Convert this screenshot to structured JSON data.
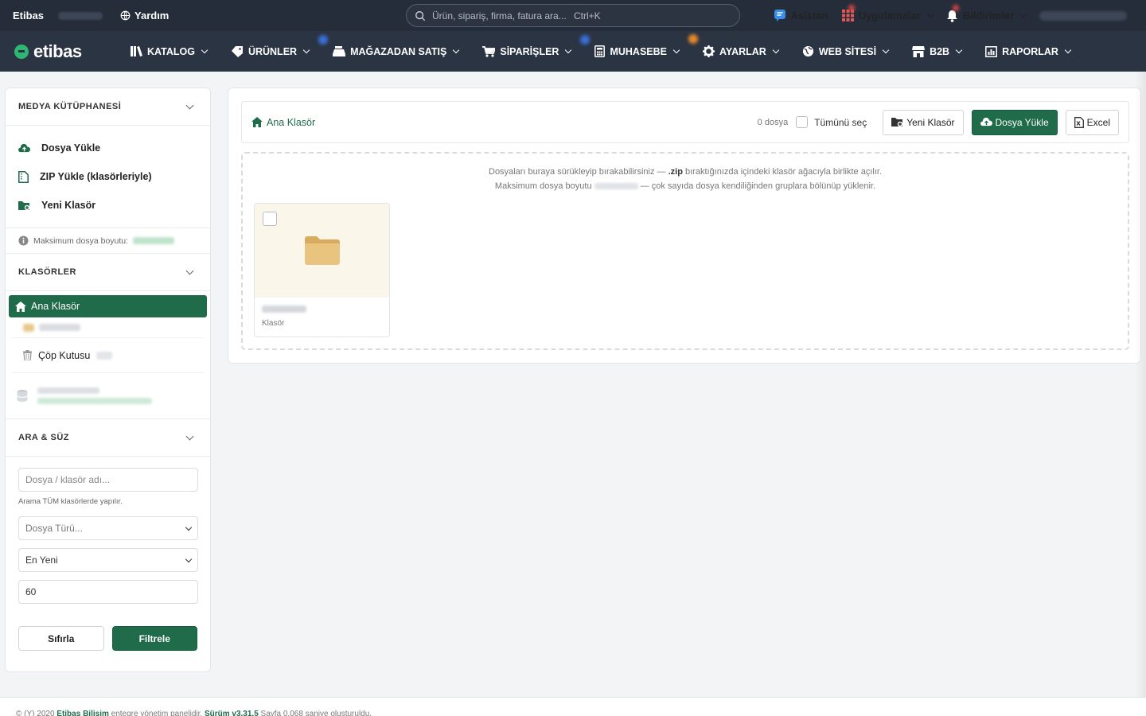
{
  "topbar": {
    "brand": "Etibas",
    "help": "Yardım",
    "search_placeholder": "Ürün, sipariş, firma, fatura ara...",
    "search_shortcut": "Ctrl+K",
    "assistant": "Asistan",
    "apps": "Uygulamalar",
    "notifications": "Bildirimler"
  },
  "nav": {
    "logo": "etibas",
    "items": [
      "KATALOG",
      "ÜRÜNLER",
      "MAĞAZADAN SATIŞ",
      "SİPARİŞLER",
      "MUHASEBE",
      "AYARLAR",
      "WEB SİTESİ",
      "B2B",
      "RAPORLAR"
    ]
  },
  "sidebar": {
    "media_title": "MEDYA KÜTÜPHANESİ",
    "actions": [
      "Dosya Yükle",
      "ZIP Yükle (klasörleriyle)",
      "Yeni Klasör"
    ],
    "max_size_label": "Maksimum dosya boyutu:",
    "folders_title": "KLASÖRLER",
    "root_folder": "Ana Klasör",
    "trash": "Çöp Kutusu",
    "filter_title": "ARA & SÜZ",
    "search_placeholder": "Dosya / klasör adı...",
    "search_hint": "Arama TÜM klasörlerde yapılır.",
    "type_placeholder": "Dosya Türü...",
    "sort_value": "En Yeni",
    "per_page_value": "60",
    "reset": "Sıfırla",
    "filter": "Filtrele"
  },
  "main": {
    "breadcrumb": "Ana Klasör",
    "file_count": "0 dosya",
    "select_all": "Tümünü seç",
    "new_folder": "Yeni Klasör",
    "upload": "Dosya Yükle",
    "excel": "Excel",
    "drop_line1_a": "Dosyaları buraya sürükleyip bırakabilirsiniz — ",
    "drop_line1_zip": ".zip",
    "drop_line1_b": " bıraktığınızda içindeki klasör ağacıyla birlikte açılır.",
    "drop_line2_a": "Maksimum dosya boyutu ",
    "drop_line2_b": " — çok sayıda dosya kendiliğinden gruplara bölünüp yüklenir.",
    "card_type": "Klasör"
  },
  "footer": {
    "prefix": "© (Y) 2020 ",
    "company": "Etibas Bilişim",
    "mid": " entegre yönetim panelidir. ",
    "version": "Sürüm v3.31.5",
    "suffix": " Sayfa 0.068 saniye oluşturuldu."
  },
  "colors": {
    "primary": "#1f6b4a",
    "topbar": "#252d3a",
    "navbar": "#2b3442",
    "logo_accent": "#2eb672"
  }
}
